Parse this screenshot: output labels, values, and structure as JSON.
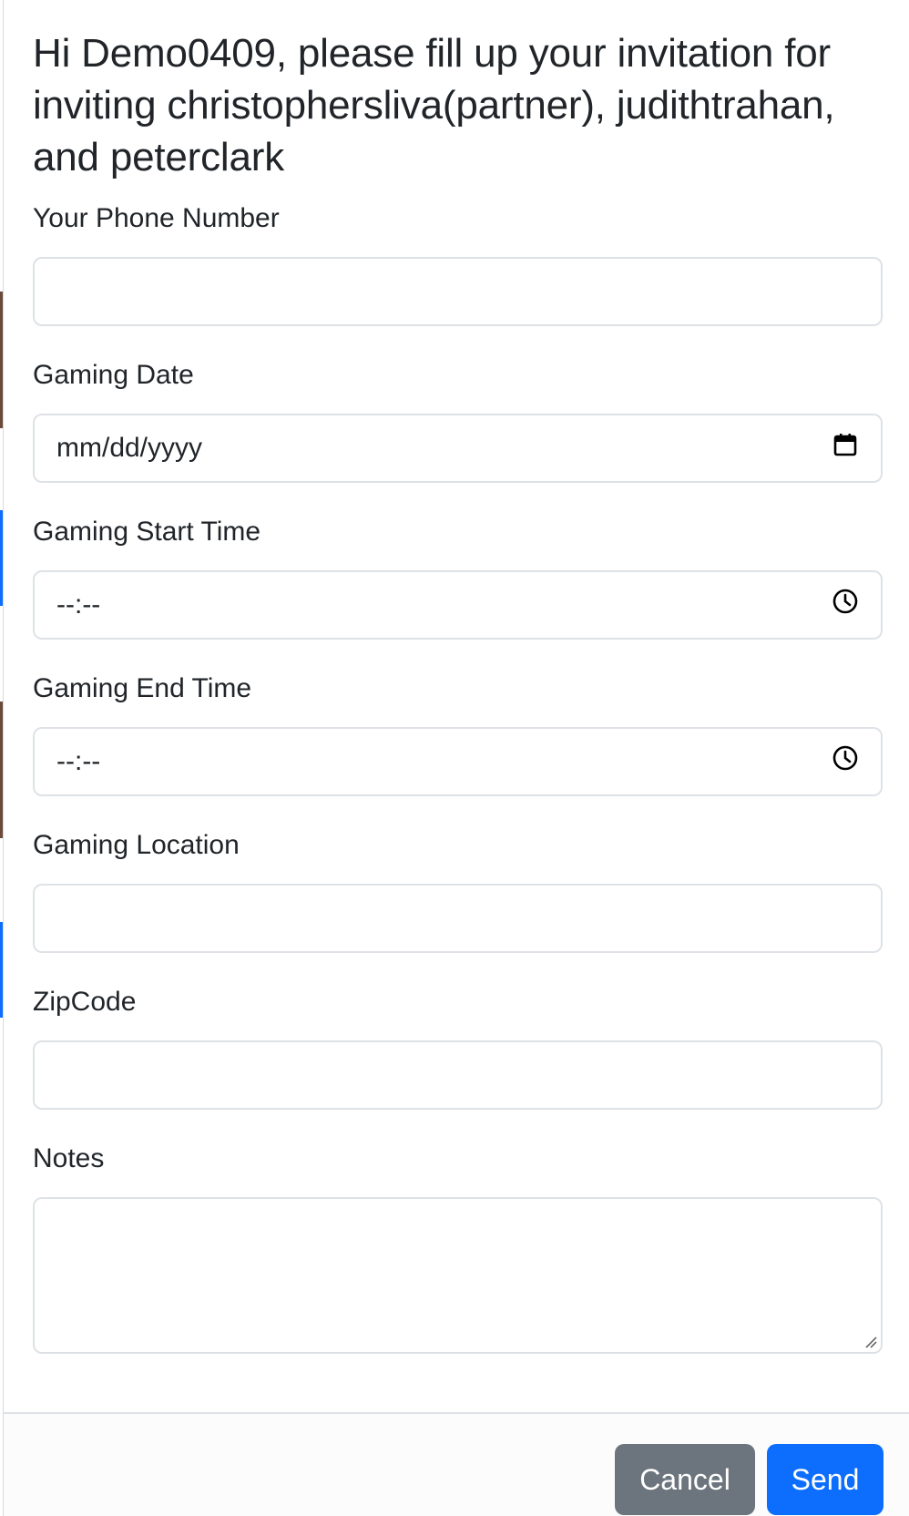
{
  "modal": {
    "title": "Hi Demo0409, please fill up your invitation for inviting christophersliva(partner), judithtrahan, and peterclark"
  },
  "form": {
    "phone": {
      "label": "Your Phone Number",
      "value": ""
    },
    "date": {
      "label": "Gaming Date",
      "placeholder": "mm/dd/yyyy",
      "icon": "calendar-icon"
    },
    "start_time": {
      "label": "Gaming Start Time",
      "placeholder": "--:--",
      "icon": "clock-icon"
    },
    "end_time": {
      "label": "Gaming End Time",
      "placeholder": "--:--",
      "icon": "clock-icon"
    },
    "location": {
      "label": "Gaming Location",
      "value": ""
    },
    "zipcode": {
      "label": "ZipCode",
      "value": ""
    },
    "notes": {
      "label": "Notes",
      "value": ""
    }
  },
  "footer": {
    "cancel_label": "Cancel",
    "send_label": "Send"
  },
  "colors": {
    "primary": "#0d6efd",
    "secondary": "#6c757d",
    "border": "#dee2e6",
    "text": "#212529"
  }
}
